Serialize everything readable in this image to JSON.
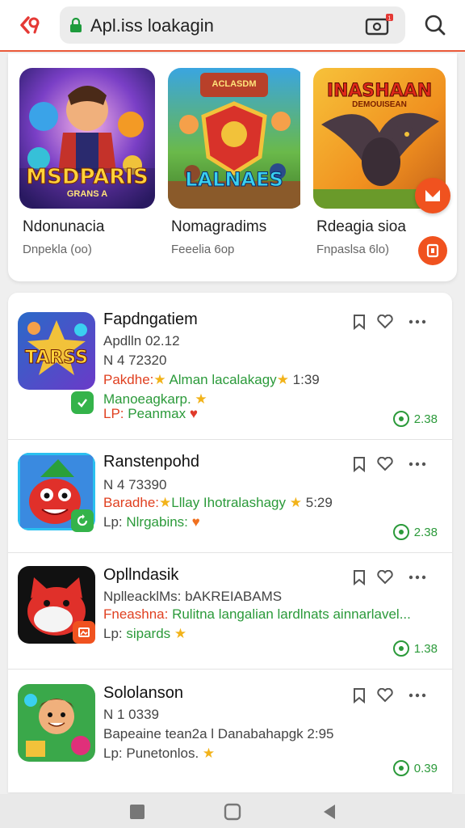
{
  "browser": {
    "url_text": "Apl.iss loakagin",
    "tab_badge": "1"
  },
  "featured": [
    {
      "title": "Ndonunacia",
      "subtitle": "Dnpekla (oo)",
      "art_text": "MSDPARIS",
      "art_subtext": "GRANS A"
    },
    {
      "title": "Nomagradims",
      "subtitle": "Feeelia 6op",
      "art_text": "LALNAES",
      "art_subtext": "ACLASDM"
    },
    {
      "title": "Rdeagia sioa",
      "subtitle": "Fnpaslsa 6lo)",
      "art_text": "INASHAAN",
      "art_subtext": "DEMOUISEAN"
    }
  ],
  "list": [
    {
      "title": "Fapdngatiem",
      "line2": "Apdlln 02.12",
      "line3": "N 4 72320",
      "line4_label": "Pakdhe:",
      "line4_text": "Alman lacalakagy",
      "line4_value": "1:39",
      "line5": "Manoeagkarp.",
      "line6_prefix": "LP:",
      "line6_text": "Peanmax",
      "download": "2.38",
      "art_text": "TARSS"
    },
    {
      "title": "Ranstenpohd",
      "line2": "N 4 73390",
      "line3_label": "Baradhe:",
      "line3_text": "Lllay Ihotralashagy",
      "line3_value": "5:29",
      "line4_prefix": "Lp:",
      "line4_text": "Nlrgabins:",
      "download": "2.38"
    },
    {
      "title": "Opllndasik",
      "line2": "NplleacklMs: bAKREIABAMS",
      "line3_label": "Fneashna:",
      "line3_text": "Rulitna langalian lardlnats ainnarlavel...",
      "line4_prefix": "Lp:",
      "line4_text": "sipards",
      "download": "1.38"
    },
    {
      "title": "Sololanson",
      "line2": "N 1 0339",
      "line3": "Bapeaine tean2a l Danabahapgk",
      "line3_value": "2:95",
      "line4_prefix": "Lp:",
      "line4_text": "Punetonlos.",
      "download": "0.39"
    }
  ],
  "colors": {
    "accent": "#f0521f",
    "green": "#2b9a3a",
    "red": "#e04020",
    "star": "#f2b31a"
  },
  "icons": [
    "back-icon",
    "lock-icon",
    "tab-switcher-icon",
    "search-icon",
    "bookmark-icon",
    "heart-icon",
    "more-icon",
    "download-icon",
    "nav-recent-icon",
    "nav-home-icon",
    "nav-back-icon"
  ]
}
